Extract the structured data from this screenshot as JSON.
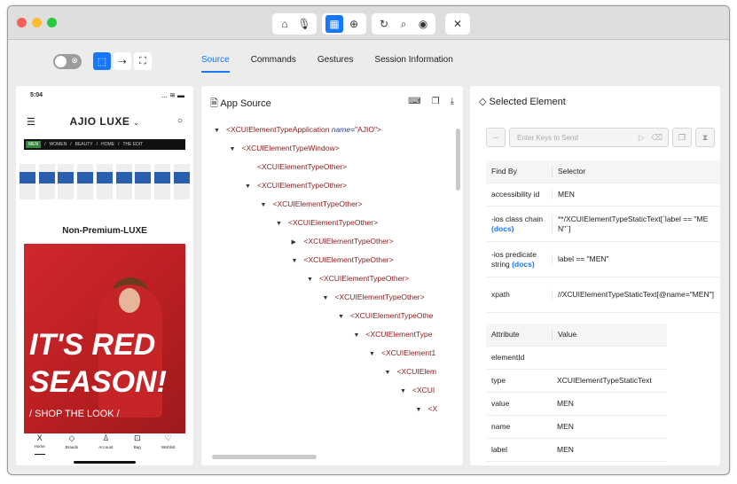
{
  "toolbar": {
    "icons": [
      "home-icon",
      "mic-icon",
      "grid-icon",
      "globe-icon",
      "refresh-icon",
      "search-icon",
      "eye-icon",
      "close-icon"
    ]
  },
  "modes": {
    "icons": [
      "select-icon",
      "swipe-icon",
      "crop-icon"
    ]
  },
  "tabs": [
    "Source",
    "Commands",
    "Gestures",
    "Session Information"
  ],
  "device": {
    "time": "5:04",
    "status_right": "... ≋ ▬",
    "brand": "AJIO LUXE",
    "categories": [
      "MEN",
      "WOMEN",
      "BEAUTY",
      "HOME",
      "THE EDIT"
    ],
    "banner_title": "Non-Premium-LUXE",
    "hero_line1": "IT'S RED",
    "hero_line2": "SEASON!",
    "hero_cta": "/ SHOP THE LOOK /",
    "bottom_nav": [
      "Home",
      "Brands",
      "Account",
      "Bag",
      "Wishlist"
    ]
  },
  "source": {
    "title": "App Source",
    "nodes": [
      {
        "depth": 0,
        "arrow": "▼",
        "text": "<XCUIElementTypeApplication ",
        "attr": "name=",
        "val": "\"AJIO\">"
      },
      {
        "depth": 1,
        "arrow": "▼",
        "text": "<XCUIElementTypeWindow>"
      },
      {
        "depth": 2,
        "arrow": "",
        "text": "<XCUIElementTypeOther>"
      },
      {
        "depth": 2,
        "arrow": "▼",
        "text": "<XCUIElementTypeOther>"
      },
      {
        "depth": 3,
        "arrow": "▼",
        "text": "<XCUIElementTypeOther>"
      },
      {
        "depth": 4,
        "arrow": "▼",
        "text": "<XCUIElementTypeOther>"
      },
      {
        "depth": 5,
        "arrow": "▶",
        "text": "<XCUIElementTypeOther>"
      },
      {
        "depth": 5,
        "arrow": "▼",
        "text": "<XCUIElementTypeOther>"
      },
      {
        "depth": 6,
        "arrow": "▼",
        "text": "<XCUIElementTypeOther>"
      },
      {
        "depth": 7,
        "arrow": "▼",
        "text": "<XCUIElementTypeOther>"
      },
      {
        "depth": 8,
        "arrow": "▼",
        "text": "<XCUIElementTypeOthe"
      },
      {
        "depth": 9,
        "arrow": "▼",
        "text": "<XCUIElementType"
      },
      {
        "depth": 10,
        "arrow": "▼",
        "text": "<XCUIElement1"
      },
      {
        "depth": 11,
        "arrow": "▼",
        "text": "<XCUIElem"
      },
      {
        "depth": 12,
        "arrow": "▼",
        "text": "<XCUI"
      },
      {
        "depth": 13,
        "arrow": "▼",
        "text": "<X"
      }
    ]
  },
  "selected": {
    "title": "Selected Element",
    "keys_placeholder": "Enter Keys to Send",
    "find_header": [
      "Find By",
      "Selector"
    ],
    "find_rows": [
      {
        "by": "accessibility id",
        "docs": "",
        "sel": "MEN"
      },
      {
        "by": "-ios class chain",
        "docs": "(docs)",
        "sel": "**/XCUIElementTypeStaticText[`label == \"MEN\"`]"
      },
      {
        "by": "-ios predicate string",
        "docs": "(docs)",
        "sel": "label == \"MEN\""
      },
      {
        "by": "xpath",
        "docs": "",
        "sel": "//XCUIElementTypeStaticText[@name=\"MEN\"]"
      }
    ],
    "attr_header": [
      "Attribute",
      "Value"
    ],
    "attr_rows": [
      {
        "k": "elementId",
        "v": ""
      },
      {
        "k": "type",
        "v": "XCUIElementTypeStaticText"
      },
      {
        "k": "value",
        "v": "MEN"
      },
      {
        "k": "name",
        "v": "MEN"
      },
      {
        "k": "label",
        "v": "MEN"
      }
    ]
  },
  "colors": {
    "accent": "#1677ff",
    "close": "#ff5f57",
    "minimize": "#febc2e",
    "zoom": "#28c840"
  }
}
